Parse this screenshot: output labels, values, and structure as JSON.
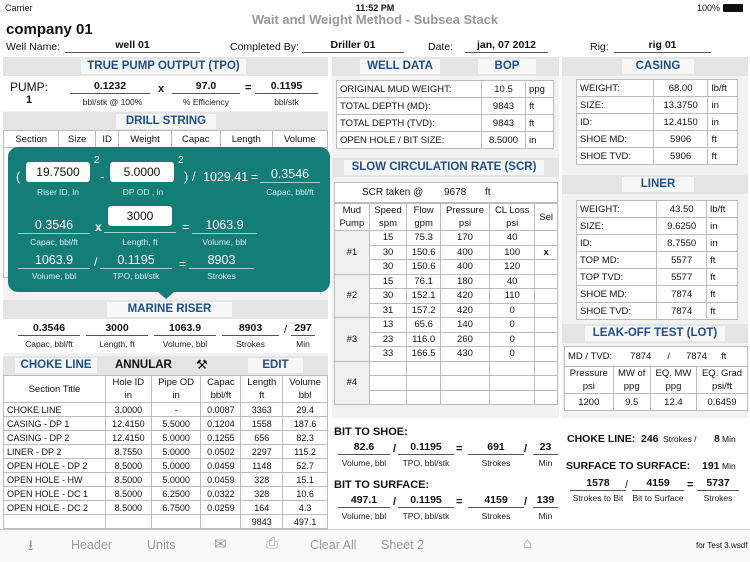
{
  "status": {
    "carrier": "Carrier",
    "time": "11:52 PM",
    "battery": "100%"
  },
  "app_title": "Wait and Weight Method - Subsea Stack",
  "company": "company 01",
  "header": {
    "well_name_label": "Well Name:",
    "well_name": "well 01",
    "completed_by_label": "Completed By:",
    "completed_by": "Driller 01",
    "date_label": "Date:",
    "date": "jan, 07 2012",
    "rig_label": "Rig:",
    "rig": "rig 01"
  },
  "tpo": {
    "title": "TRUE PUMP OUTPUT (TPO)",
    "pump_label": "PUMP:",
    "pump_no": "1",
    "output": "0.1232",
    "output_unit": "bbl/stk   @ 100%",
    "efficiency": "97.0",
    "efficiency_unit": "% Efficiency",
    "result": "0.1195",
    "result_unit": "bbl/stk",
    "op_x": "x",
    "op_eq": "="
  },
  "drill_string": {
    "title": "DRILL STRING",
    "columns": [
      "Section",
      "Size",
      "ID",
      "Weight",
      "Capac",
      "Length",
      "Volume"
    ]
  },
  "popover": {
    "riser_id": "19.7500",
    "riser_id_label": "Riser ID,  in",
    "dp_od": "5.0000",
    "dp_od_label": "DP OD ,  in",
    "divisor": "1029.41",
    "capac": "0.3546",
    "capac_label": "Capac, bbl/ft",
    "capac2": "0.3546",
    "length": "3000",
    "length_label": "Length, ft",
    "volume": "1063.9",
    "volume_label": "Volume,  bbl",
    "volume2": "1063.9",
    "volume2_label": "Volume, bbl",
    "tpo": "0.1195",
    "tpo_label": "TPO,  bbl/stk",
    "strokes": "8903",
    "strokes_label": "Strokes",
    "exp": "2"
  },
  "marine_riser": {
    "title": "MARINE RISER",
    "capac": "0.3546",
    "capac_label": "Capac, bbl/ft",
    "length": "3000",
    "length_label": "Length, ft",
    "volume": "1063.9",
    "volume_label": "Volume, bbl",
    "strokes": "8903",
    "strokes_label": "Strokes",
    "min": "297",
    "min_label": "Min"
  },
  "annular": {
    "tab_choke": "CHOKE LINE",
    "tab_annular": "ANNULAR",
    "tab_edit": "EDIT",
    "icon": "tools-icon",
    "columns": [
      "Section Title",
      "Hole ID\nin",
      "Pipe OD\nin",
      "Capac\nbbl/ft",
      "Length\nft",
      "Volume\nbbl"
    ],
    "rows": [
      [
        "CHOKE LINE",
        "3.0000",
        "-",
        "0.0087",
        "3363",
        "29.4"
      ],
      [
        "CASING - DP 1",
        "12.4150",
        "5.5000",
        "0.1204",
        "1558",
        "187.6"
      ],
      [
        "CASING - DP 2",
        "12.4150",
        "5.0000",
        "0.1255",
        "656",
        "82.3"
      ],
      [
        "LINER - DP 2",
        "8.7550",
        "5.0000",
        "0.0502",
        "2297",
        "115.2"
      ],
      [
        "OPEN HOLE - DP 2",
        "8.5000",
        "5.0000",
        "0.0459",
        "1148",
        "52.7"
      ],
      [
        "OPEN HOLE - HW",
        "8.5000",
        "5.0000",
        "0.0459",
        "328",
        "15.1"
      ],
      [
        "OPEN HOLE - DC 1",
        "8.5000",
        "6.2500",
        "0.0322",
        "328",
        "10.6"
      ],
      [
        "OPEN HOLE - DC 2",
        "8.5000",
        "6.7500",
        "0.0259",
        "164",
        "4.3"
      ],
      [
        "",
        "",
        "",
        "",
        "9843",
        "497.1"
      ]
    ]
  },
  "well_data": {
    "tab_well": "WELL DATA",
    "tab_bop": "BOP",
    "rows": [
      [
        "ORIGINAL MUD WEIGHT:",
        "10.5",
        "ppg"
      ],
      [
        "TOTAL DEPTH (MD):",
        "9843",
        "ft"
      ],
      [
        "TOTAL DEPTH (TVD):",
        "9843",
        "ft"
      ],
      [
        "OPEN HOLE / BIT SIZE:",
        "8.5000",
        "in"
      ]
    ]
  },
  "scr": {
    "title": "SLOW CIRCULATION RATE (SCR)",
    "taken_label": "SCR taken @",
    "taken_depth": "9678",
    "taken_unit": "ft",
    "columns": [
      "Mud\nPump",
      "Speed\nspm",
      "Flow\ngpm",
      "Pressure\npsi",
      "CL Loss\npsi",
      "Sel"
    ],
    "pumps": [
      {
        "name": "#1",
        "rows": [
          [
            "15",
            "75.3",
            "170",
            "40",
            ""
          ],
          [
            "30",
            "150.6",
            "400",
            "100",
            "x"
          ],
          [
            "30",
            "150.6",
            "400",
            "120",
            ""
          ]
        ]
      },
      {
        "name": "#2",
        "rows": [
          [
            "15",
            "76.1",
            "180",
            "40",
            ""
          ],
          [
            "30",
            "152.1",
            "420",
            "110",
            ""
          ],
          [
            "31",
            "157.2",
            "420",
            "0",
            ""
          ]
        ]
      },
      {
        "name": "#3",
        "rows": [
          [
            "13",
            "65.6",
            "140",
            "0",
            ""
          ],
          [
            "23",
            "116.0",
            "260",
            "0",
            ""
          ],
          [
            "33",
            "166.5",
            "430",
            "0",
            ""
          ]
        ]
      },
      {
        "name": "#4",
        "rows": [
          [
            "",
            "",
            "",
            "",
            ""
          ],
          [
            "",
            "",
            "",
            "",
            ""
          ],
          [
            "",
            "",
            "",
            "",
            ""
          ]
        ]
      }
    ]
  },
  "casing": {
    "title": "CASING",
    "rows": [
      [
        "WEIGHT:",
        "68.00",
        "lb/ft"
      ],
      [
        "SIZE:",
        "13.3750",
        "in"
      ],
      [
        "ID:",
        "12.4150",
        "in"
      ],
      [
        "SHOE MD:",
        "5906",
        "ft"
      ],
      [
        "SHOE TVD:",
        "5906",
        "ft"
      ]
    ]
  },
  "liner": {
    "title": "LINER",
    "rows": [
      [
        "WEIGHT:",
        "43.50",
        "lb/ft"
      ],
      [
        "SIZE:",
        "9.6250",
        "in"
      ],
      [
        "ID:",
        "8.7550",
        "in"
      ],
      [
        "TOP MD:",
        "5577",
        "ft"
      ],
      [
        "TOP TVD:",
        "5577",
        "ft"
      ],
      [
        "SHOE MD:",
        "7874",
        "ft"
      ],
      [
        "SHOE TVD:",
        "7874",
        "ft"
      ]
    ]
  },
  "lot": {
    "title": "LEAK-OFF TEST (LOT)",
    "md_tvd_label": "MD / TVD:",
    "md": "7874",
    "sep": "/",
    "tvd": "7874",
    "unit": "ft",
    "columns": [
      "Pressure\npsi",
      "MW of\nppg",
      "EQ. MW\nppg",
      "EQ. Grad\npsi/ft"
    ],
    "values": [
      "1200",
      "9.5",
      "12.4",
      "0.6459"
    ]
  },
  "bit_to_shoe": {
    "title": "BIT TO SHOE:",
    "volume": "82.6",
    "volume_label": "Volume, bbl",
    "tpo": "0.1195",
    "tpo_label": "TPO, bbl/stk",
    "strokes": "691",
    "strokes_label": "Strokes",
    "min": "23",
    "min_label": "Min"
  },
  "bit_to_surface": {
    "title": "BIT TO SURFACE:",
    "volume": "497.1",
    "volume_label": "Volume, bbl",
    "tpo": "0.1195",
    "tpo_label": "TPO, bbl/stk",
    "strokes": "4159",
    "strokes_label": "Strokes",
    "min": "139",
    "min_label": "Min"
  },
  "choke_line": {
    "title": "CHOKE LINE:",
    "strokes": "246",
    "strokes_label": "Strokes /",
    "min": "8",
    "min_label": "Min"
  },
  "surface": {
    "title": "SURFACE TO SURFACE:",
    "min": "191",
    "min_label": "Min",
    "to_bit": "1578",
    "to_bit_label": "Strokes to Bit",
    "bit_surface": "4159",
    "bit_surface_label": "Bit to Surface",
    "strokes": "5737",
    "strokes_label": "Strokes"
  },
  "toolbar": {
    "header": "Header",
    "units": "Units",
    "clear_all": "Clear All",
    "sheet2": "Sheet 2",
    "file": "for Test 3.wsdf"
  },
  "colors": {
    "accent": "#1d4f8c",
    "popover": "#137d78",
    "band": "#e4e4e4"
  }
}
